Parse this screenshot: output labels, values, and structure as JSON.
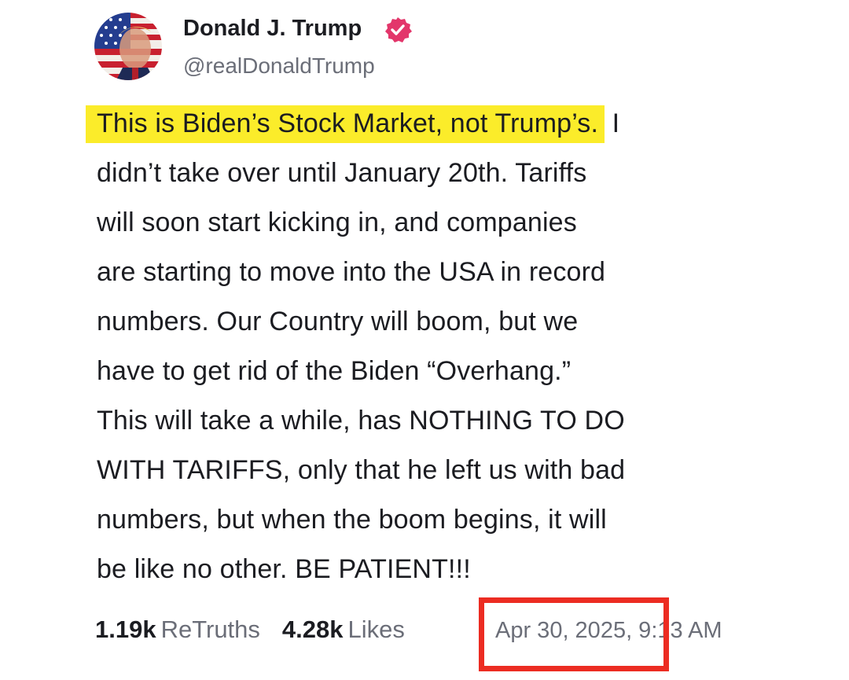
{
  "author": {
    "display_name": "Donald J. Trump",
    "handle": "@realDonaldTrump",
    "verified": true,
    "avatar_icon": "flag-portrait-avatar",
    "verified_icon": "verified-badge-icon"
  },
  "post": {
    "highlighted_text": "This is Biden’s Stock Market, not Trump’s.",
    "lines": [
      " I",
      "didn’t take over until January 20th. Tariffs",
      "will soon start kicking in, and companies",
      "are starting to move into the USA in record",
      "numbers. Our Country will boom, but we",
      "have to get rid of the Biden “Overhang.”",
      "This will take a while, has NOTHING TO DO",
      "WITH TARIFFS, only that he left us with bad",
      "numbers, but when the boom begins, it will",
      "be like no other. BE PATIENT!!!"
    ]
  },
  "stats": {
    "retruths_count": "1.19k",
    "retruths_label": "ReTruths",
    "likes_count": "4.28k",
    "likes_label": "Likes",
    "timestamp": "Apr 30, 2025, 9:13 AM"
  },
  "colors": {
    "highlight": "#fbec2a",
    "verified_badge": "#e3366b",
    "annotation_box": "#ec2c22",
    "secondary_text": "#6b6e78",
    "primary_text": "#1b1c21"
  }
}
